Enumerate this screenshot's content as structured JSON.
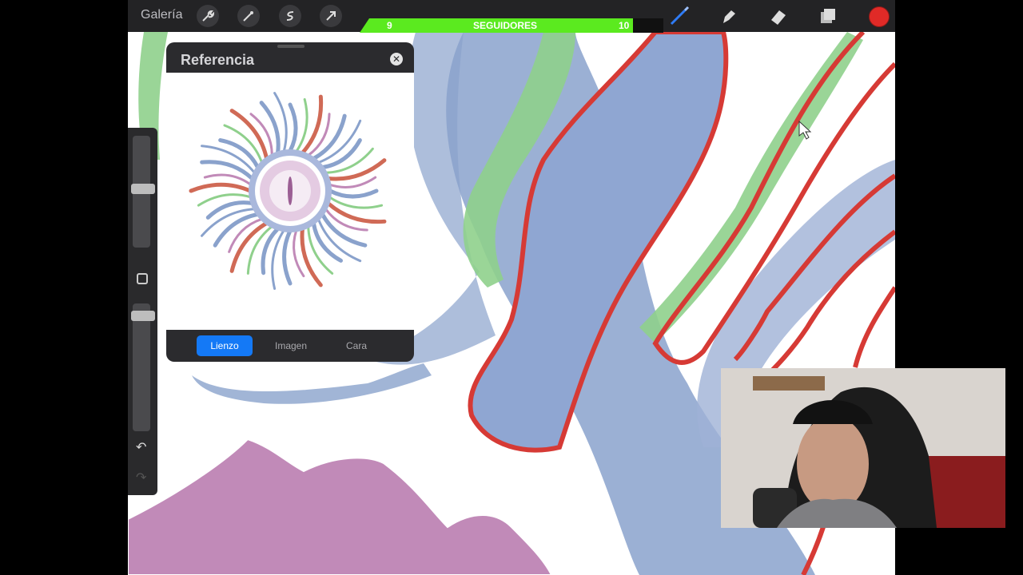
{
  "topbar": {
    "gallery_label": "Galería",
    "left_tools": [
      "wrench-icon",
      "magic-wand-icon",
      "selection-icon",
      "transform-arrow-icon"
    ],
    "right_tools": [
      "brush-icon",
      "smudge-icon",
      "eraser-icon",
      "layers-icon"
    ],
    "current_color": "#e02a27"
  },
  "followers_overlay": {
    "current": "9",
    "label": "SEGUIDORES",
    "goal": "10",
    "progress": 0.9,
    "bar_color": "#5bea1f"
  },
  "reference_panel": {
    "title": "Referencia",
    "tabs": [
      {
        "label": "Lienzo",
        "active": true
      },
      {
        "label": "Imagen",
        "active": false
      },
      {
        "label": "Cara",
        "active": false
      }
    ]
  },
  "colors": {
    "stroke_red": "#d63a35",
    "stroke_blue": "#8aa2cc",
    "stroke_green": "#8fd08c",
    "stroke_pink": "#c18ab8"
  }
}
